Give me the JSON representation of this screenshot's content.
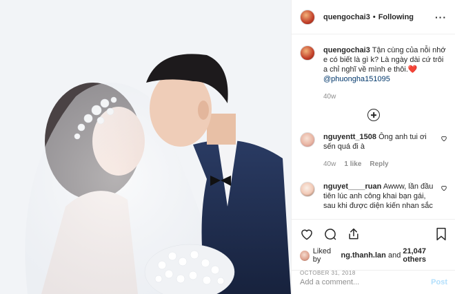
{
  "header": {
    "username": "quengochai3",
    "separator": "•",
    "follow_status": "Following",
    "more": "···"
  },
  "caption": {
    "username": "quengochai3",
    "text": "Tận cùng của nỗi nhớ e có biết là gì k? Là ngày dài cứ trôi a chỉ nghĩ về mình e thôi.",
    "emoji": "❤️",
    "mention": "@phuongha151095",
    "time": "40w"
  },
  "comments": [
    {
      "username": "nguyentt_1508",
      "text": "Ông anh tui ơi sến quá đi à",
      "time": "40w",
      "likes": "1 like",
      "reply": "Reply"
    },
    {
      "username": "nguyet____ruan",
      "text": "Awww, lần đầu tiên lúc anh công khai bạn gái, sau khi được diện kiến nhan sắc",
      "time": "",
      "likes": "",
      "reply": ""
    }
  ],
  "likes": {
    "prefix": "Liked by",
    "user": "ng.thanh.lan",
    "and": "and",
    "others": "21,047 others"
  },
  "date": "OCTOBER 31, 2018",
  "add_comment": {
    "placeholder": "Add a comment...",
    "post_label": "Post"
  },
  "colors": {
    "text": "#262626",
    "muted": "#8e8e8e",
    "mention": "#00376b",
    "post_disabled": "#b2dffc",
    "heart": "#ed4956",
    "suit": "#1f2d4d"
  },
  "icons": {
    "heart": "heart-icon",
    "comment": "comment-icon",
    "share": "share-icon",
    "save": "bookmark-icon",
    "add": "plus-circle-icon"
  }
}
